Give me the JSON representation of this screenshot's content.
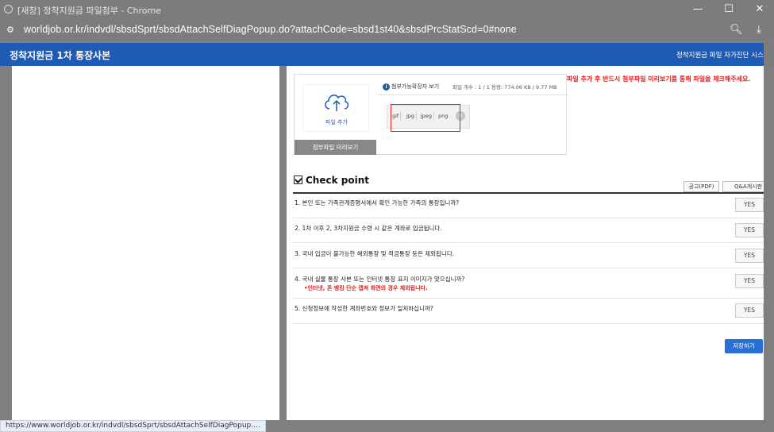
{
  "window": {
    "title": "[새창] 정착지원금 파일첨부 - Chrome",
    "minimize": "—",
    "maximize": "☐",
    "close": "✕"
  },
  "address": {
    "url": "worldjob.or.kr/indvdl/sbsdSprt/sbsdAttachSelfDiagPopup.do?attachCode=sbsd1st40&sbsdPrcStatScd=0#none"
  },
  "header": {
    "title": "정착지원금 1차 통장사본",
    "right_text": "정착지원금 파일 자가진단 시스템"
  },
  "upload": {
    "add_label": "파일 추가",
    "preview_button": "첨부파일 미리보기",
    "guide_label": "첨부가능확장자 보기",
    "count_text": "파일 개수 : 1 / 1    용량: 774.06 KB / 9.77 MB",
    "extensions": [
      "gif",
      "jpg",
      "jpeg",
      "png"
    ],
    "warning": "파일 추가 후 반드시 첨부파일 미리보기를 통해 파일을 체크해주세요."
  },
  "checkpoint": {
    "title": "Check point",
    "notice_button": "공고(PDF)",
    "qa_button": "Q&A게시판",
    "questions": [
      {
        "text": "1.  본인 또는 가족관계증명서에서 확인 가능한 가족의 통장입니까?",
        "answer": "YES"
      },
      {
        "text": "2.  1차 이후 2, 3차지원금 수령 시 같은 계좌로 입금됩니다.",
        "answer": "YES"
      },
      {
        "text": "3.  국내 입금이 불가능한 해외통장 및 적금통장 등은 제외됩니다.",
        "answer": "YES"
      },
      {
        "text": "4.  국내 실물 통장 사본 또는 인터넷 통장 표지 이미지가 맞으십니까?",
        "sub": "•인터넷, 폰 뱅킹 단순 캡쳐 화면의 경우 제외됩니다.",
        "answer": "YES"
      },
      {
        "text": "5.  신청정보에 작성한 계좌번호와 정보가 일치하십니까?",
        "answer": "YES"
      }
    ],
    "save_button": "저장하기"
  },
  "status": {
    "link": "https://www.worldjob.or.kr/indvdl/sbsdSprt/sbsdAttachSelfDiagPopup...."
  }
}
